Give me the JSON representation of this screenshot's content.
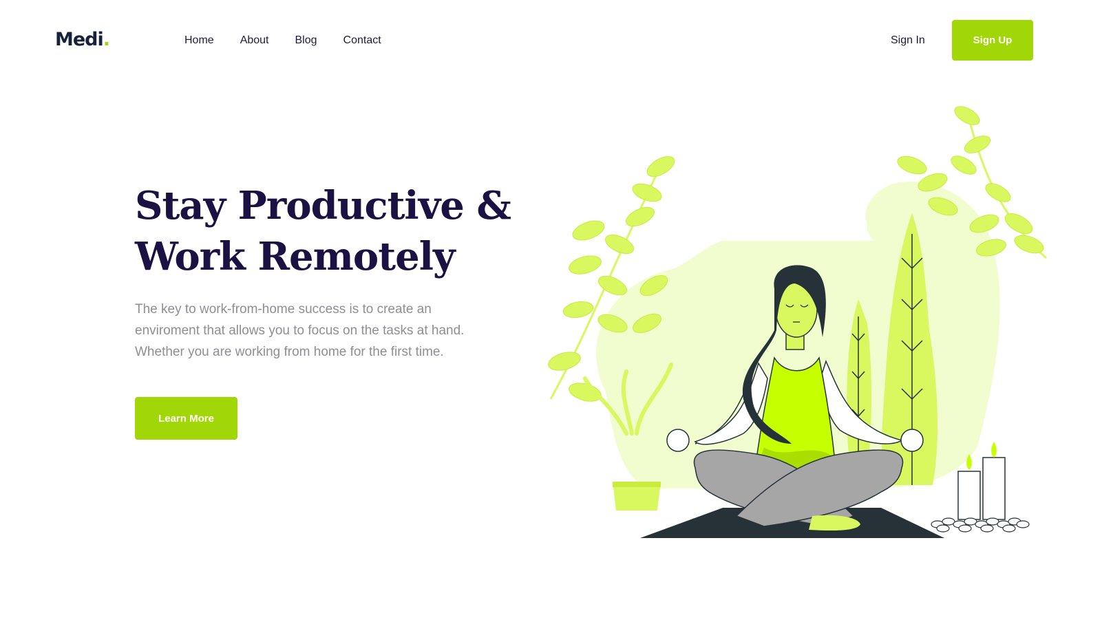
{
  "header": {
    "logo_text": "Medi",
    "logo_dot": ".",
    "nav": [
      "Home",
      "About",
      "Blog",
      "Contact"
    ],
    "sign_in": "Sign In",
    "sign_up": "Sign Up"
  },
  "hero": {
    "title_line1": "Stay Productive &",
    "title_line2": "Work Remotely",
    "text_line1": "The key to work-from-home success is to create an",
    "text_line2": "enviroment that allows you to focus on the tasks at hand.",
    "text_line3": "Whether you are working from home for the first time.",
    "cta": "Learn More"
  },
  "illustration": {
    "subject": "meditating-woman",
    "elements": [
      "plant-icon",
      "tree-icon",
      "candle-icon",
      "yoga-mat"
    ]
  },
  "colors": {
    "accent": "#a2d707",
    "heading": "#1c1143",
    "body_text": "#8e8e95",
    "light_green": "#f1fccf",
    "mid_green": "#d9f85f",
    "dark": "#263238"
  }
}
